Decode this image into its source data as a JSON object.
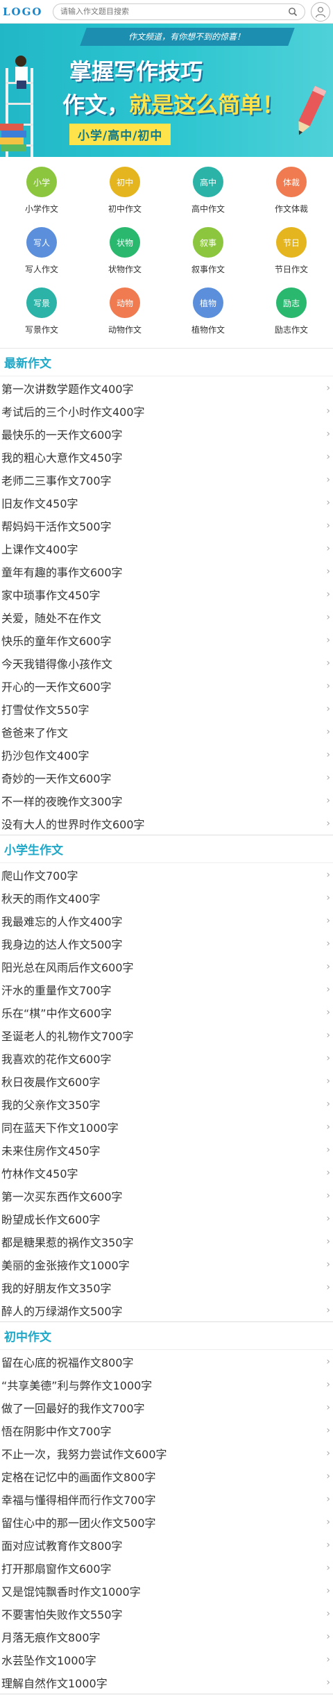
{
  "header": {
    "logo": "LOGO",
    "search_placeholder": "请输入作文题目搜索"
  },
  "banner": {
    "tagline": "作文频道，有你想不到的惊喜！",
    "title_line1": "掌握写作技巧",
    "title_line2_a": "作文，",
    "title_line2_b": "就是这么简单！",
    "levels": "小学/高中/初中"
  },
  "categories": [
    {
      "circle": "小学",
      "label": "小学作文",
      "color": "#8cc63f"
    },
    {
      "circle": "初中",
      "label": "初中作文",
      "color": "#e5b51f"
    },
    {
      "circle": "高中",
      "label": "高中作文",
      "color": "#2ab3a6"
    },
    {
      "circle": "体裁",
      "label": "作文体裁",
      "color": "#f07b50"
    },
    {
      "circle": "写人",
      "label": "写人作文",
      "color": "#5b8fdc"
    },
    {
      "circle": "状物",
      "label": "状物作文",
      "color": "#2ab86f"
    },
    {
      "circle": "叙事",
      "label": "叙事作文",
      "color": "#8cc63f"
    },
    {
      "circle": "节日",
      "label": "节日作文",
      "color": "#e5b51f"
    },
    {
      "circle": "写景",
      "label": "写景作文",
      "color": "#2ab3a6"
    },
    {
      "circle": "动物",
      "label": "动物作文",
      "color": "#f07b50"
    },
    {
      "circle": "植物",
      "label": "植物作文",
      "color": "#5b8fdc"
    },
    {
      "circle": "励志",
      "label": "励志作文",
      "color": "#2ab86f"
    }
  ],
  "sections": [
    {
      "title": "最新作文",
      "items": [
        "第一次讲数学题作文400字",
        "考试后的三个小时作文400字",
        "最快乐的一天作文600字",
        "我的粗心大意作文450字",
        "老师二三事作文700字",
        "旧友作文450字",
        "帮妈妈干活作文500字",
        "上课作文400字",
        "童年有趣的事作文600字",
        "家中琐事作文450字",
        "关爱，随处不在作文",
        "快乐的童年作文600字",
        "今天我错得像小孩作文",
        "开心的一天作文600字",
        "打雪仗作文550字",
        "爸爸来了作文",
        "扔沙包作文400字",
        "奇妙的一天作文600字",
        "不一样的夜晚作文300字",
        "没有大人的世界时作文600字"
      ]
    },
    {
      "title": "小学生作文",
      "items": [
        "爬山作文700字",
        "秋天的雨作文400字",
        "我最难忘的人作文400字",
        "我身边的达人作文500字",
        "阳光总在风雨后作文600字",
        "汗水的重量作文700字",
        "乐在“棋”中作文600字",
        "圣诞老人的礼物作文700字",
        "我喜欢的花作文600字",
        "秋日夜晨作文600字",
        "我的父亲作文350字",
        "同在蓝天下作文1000字",
        "未来住房作文450字",
        "竹林作文450字",
        "第一次买东西作文600字",
        "盼望成长作文600字",
        "都是糖果惹的祸作文350字",
        "美丽的金张掖作文1000字",
        "我的好朋友作文350字",
        "醉人的万绿湖作文500字"
      ]
    },
    {
      "title": "初中作文",
      "items": [
        "留在心底的祝福作文800字",
        "“共享美德”利与弊作文1000字",
        "做了一回最好的我作文700字",
        "悟在阴影中作文700字",
        "不止一次，我努力尝试作文600字",
        "定格在记忆中的画面作文800字",
        "幸福与懂得相伴而行作文700字",
        "留住心中的那一团火作文500字",
        "面对应试教育作文800字",
        "打开那扇窗作文600字",
        "又是馄饨飘香时作文1000字",
        "不要害怕失败作文550字",
        "月落无痕作文800字",
        "水芸坠作文1000字",
        "理解自然作文1000字"
      ]
    }
  ]
}
